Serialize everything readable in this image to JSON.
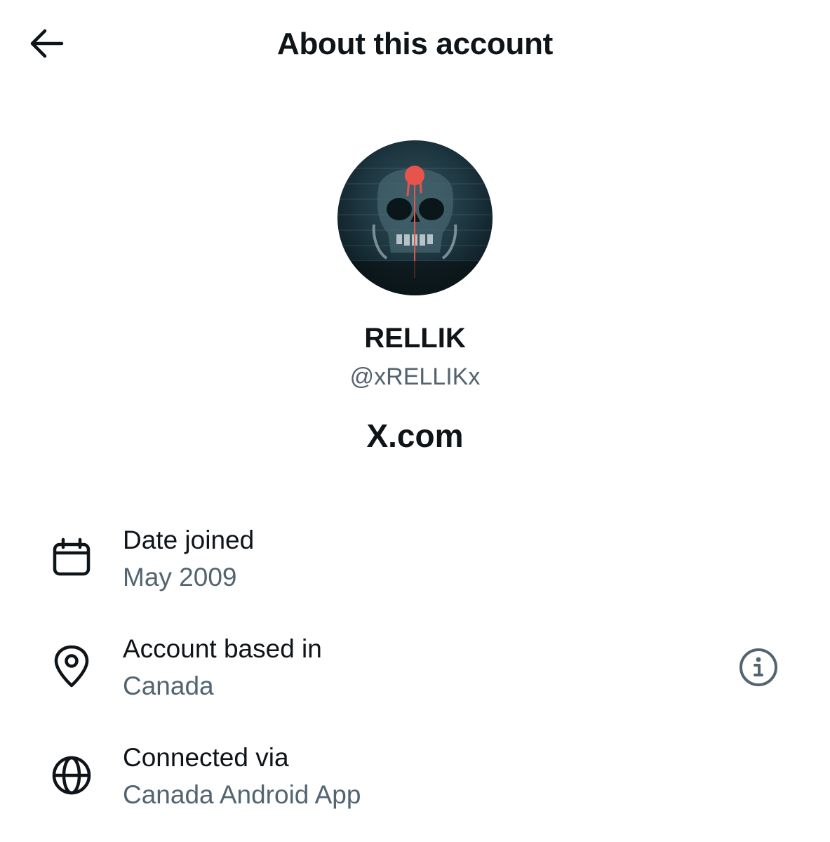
{
  "header": {
    "title": "About this account",
    "back_icon": "arrow-left-icon"
  },
  "profile": {
    "avatar_icon": "skull-avatar",
    "display_name": "RELLIK",
    "handle": "@xRELLIKx",
    "domain": "X.com"
  },
  "details": [
    {
      "icon": "calendar-icon",
      "label": "Date joined",
      "value": "May 2009"
    },
    {
      "icon": "location-pin-icon",
      "label": "Account based in",
      "value": "Canada",
      "action_icon": "info-icon"
    },
    {
      "icon": "globe-icon",
      "label": "Connected via",
      "value": "Canada Android App"
    }
  ],
  "colors": {
    "text_primary": "#0f1419",
    "text_secondary": "#536471",
    "background": "#ffffff",
    "avatar_accent": "#e8534c"
  }
}
